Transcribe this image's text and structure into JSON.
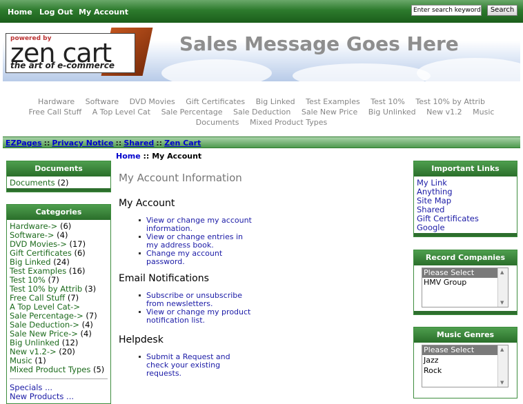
{
  "topbar": {
    "nav": [
      "Home",
      "Log Out",
      "My Account"
    ],
    "search_value": "Enter search keywords here",
    "search_button": "Search"
  },
  "header": {
    "logo_powered": "powered by",
    "logo_name": "zen cart",
    "logo_tagline": "the art of e-commerce",
    "sales_message": "Sales Message Goes Here"
  },
  "category_tabs": [
    "Hardware",
    "Software",
    "DVD Movies",
    "Gift Certificates",
    "Big Linked",
    "Test Examples",
    "Test 10%",
    "Test 10% by Attrib",
    "Free Call Stuff",
    "A Top Level Cat",
    "Sale Percentage",
    "Sale Deduction",
    "Sale New Price",
    "Big Unlinked",
    "New v1.2",
    "Music",
    "Documents",
    "Mixed Product Types"
  ],
  "ezpages": {
    "links": [
      "EZPages",
      "Privacy Notice",
      "Shared",
      "Zen Cart"
    ],
    "separator": "::"
  },
  "sidebox_documents": {
    "title": "Documents",
    "items": [
      {
        "label": "Documents",
        "count": "(2)"
      }
    ]
  },
  "sidebox_categories": {
    "title": "Categories",
    "items": [
      {
        "label": "Hardware->",
        "count": "(6)"
      },
      {
        "label": "Software->",
        "count": "(4)"
      },
      {
        "label": "DVD Movies->",
        "count": "(17)"
      },
      {
        "label": "Gift Certificates",
        "count": "(6)"
      },
      {
        "label": "Big Linked",
        "count": "(24)"
      },
      {
        "label": "Test Examples",
        "count": "(16)"
      },
      {
        "label": "Test 10%",
        "count": "(7)"
      },
      {
        "label": "Test 10% by Attrib",
        "count": "(3)"
      },
      {
        "label": "Free Call Stuff",
        "count": "(7)"
      },
      {
        "label": "A Top Level Cat->",
        "count": ""
      },
      {
        "label": "Sale Percentage->",
        "count": "(7)"
      },
      {
        "label": "Sale Deduction->",
        "count": "(4)"
      },
      {
        "label": "Sale New Price->",
        "count": "(4)"
      },
      {
        "label": "Big Unlinked",
        "count": "(12)"
      },
      {
        "label": "New v1.2->",
        "count": "(20)"
      },
      {
        "label": "Music",
        "count": "(1)"
      },
      {
        "label": "Mixed Product Types",
        "count": "(5)"
      }
    ],
    "extra": [
      "Specials ...",
      "New Products ..."
    ]
  },
  "breadcrumb": {
    "home": "Home",
    "separator": "::",
    "current": "My Account"
  },
  "main": {
    "page_title": "My Account Information",
    "sections": [
      {
        "title": "My Account",
        "links": [
          "View or change my account information.",
          "View or change entries in my address book.",
          "Change my account password."
        ]
      },
      {
        "title": "Email Notifications",
        "links": [
          "Subscribe or unsubscribe from newsletters.",
          "View or change my product notification list."
        ]
      },
      {
        "title": "Helpdesk",
        "links": [
          "Submit a Request and check your existing requests."
        ]
      }
    ]
  },
  "sidebox_important": {
    "title": "Important Links",
    "items": [
      "My Link",
      "Anything",
      "Site Map",
      "Shared",
      "Gift Certificates",
      "Google"
    ]
  },
  "sidebox_record": {
    "title": "Record Companies",
    "options": [
      "Please Select",
      "HMV Group"
    ]
  },
  "sidebox_genres": {
    "title": "Music Genres",
    "options": [
      "Please Select",
      "Jazz",
      "Rock"
    ]
  }
}
